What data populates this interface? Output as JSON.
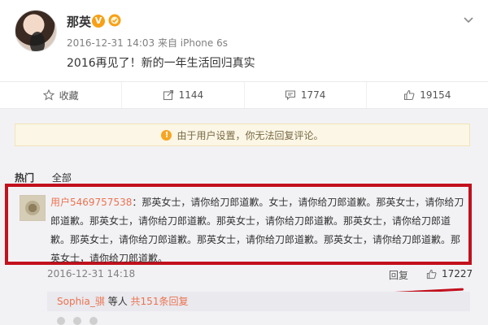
{
  "post": {
    "name": "那英",
    "verified_badge": "V",
    "timestamp": "2016-12-31 14:03",
    "source": "来自 iPhone 6s",
    "text": "2016再见了！新的一年生活回归真实"
  },
  "actions": [
    {
      "label": "收藏",
      "icon": "star-icon"
    },
    {
      "label": "1144",
      "icon": "share-icon"
    },
    {
      "label": "1774",
      "icon": "comment-icon"
    },
    {
      "label": "19154",
      "icon": "thumbs-up-icon"
    }
  ],
  "notice": {
    "text": "由于用户设置，你无法回复评论。",
    "icon": "warning-icon",
    "color": "#f6a623"
  },
  "tabs": {
    "hot": "热门",
    "all": "全部"
  },
  "comment": {
    "user": "用户5469757538",
    "text": "：那英女士，请你给刀郎道歉。女士，请你给刀郎道歉。那英女士，请你给刀郎道歉。那英女士，请你给刀郎道歉。那英女士，请你给刀郎道歉。那英女士，请你给刀郎道歉。那英女士，请你给刀郎道歉。那英女士，请你给刀郎道歉。那英女士，请你给刀郎道歉。那英女士，请你给刀郎道歉。",
    "timestamp": "2016-12-31 14:18",
    "reply_label": "回复",
    "likes": "17227"
  },
  "subreply": {
    "user": "Sophia_骐",
    "middle": "等人",
    "count": "共151条回复"
  },
  "colors": {
    "highlight_red": "#c2101d",
    "link_orange": "#eb7350",
    "vip_orange": "#f7a017"
  }
}
